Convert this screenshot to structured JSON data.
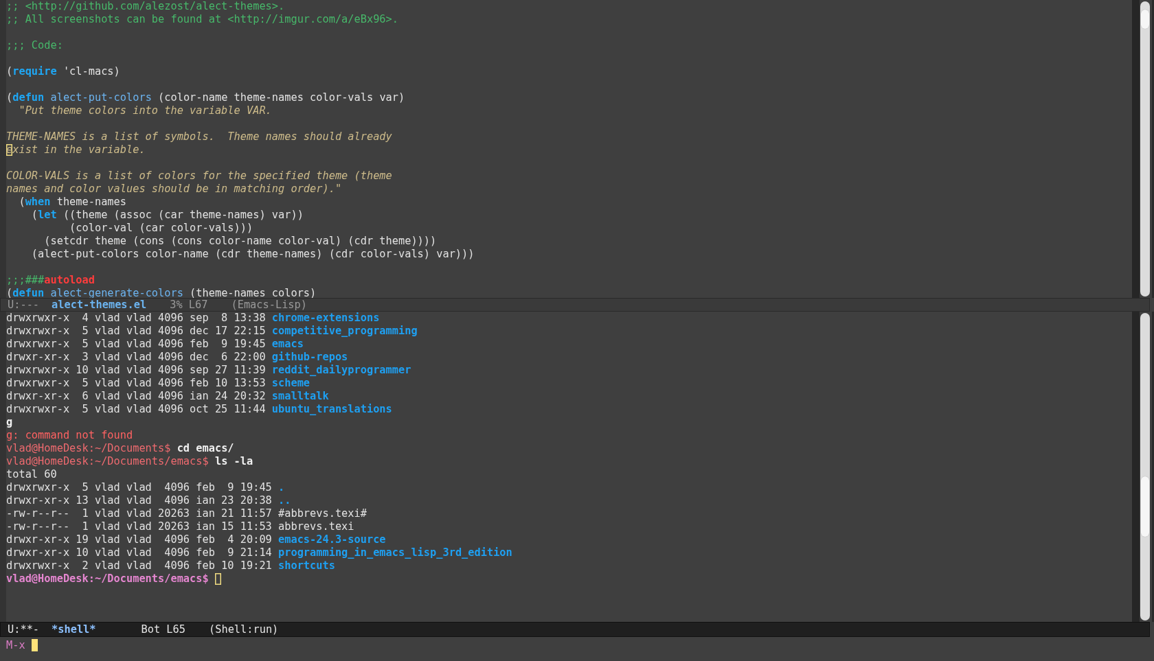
{
  "editor": {
    "lines": [
      {
        "kind": "code",
        "segments": [
          {
            "kind": "comment",
            "text": ";; <http://github.com/alezost/alect-themes>."
          }
        ]
      },
      {
        "kind": "code",
        "segments": [
          {
            "kind": "comment",
            "text": ";; All screenshots can be found at <http://imgur.com/a/eBx96>."
          }
        ]
      },
      {
        "kind": "blank"
      },
      {
        "kind": "code",
        "segments": [
          {
            "kind": "comment",
            "text": ";;; Code:"
          }
        ]
      },
      {
        "kind": "blank"
      },
      {
        "kind": "code",
        "segments": [
          {
            "kind": "plain",
            "text": "("
          },
          {
            "kind": "keyword",
            "text": "require"
          },
          {
            "kind": "plain",
            "text": " 'cl-macs)"
          }
        ]
      },
      {
        "kind": "blank"
      },
      {
        "kind": "code",
        "segments": [
          {
            "kind": "plain",
            "text": "("
          },
          {
            "kind": "keyword",
            "text": "defun"
          },
          {
            "kind": "function",
            "text": "alect-put-colors",
            "gap": true
          },
          {
            "kind": "plain",
            "text": " (color-name theme-names color-vals var)"
          }
        ]
      },
      {
        "kind": "code",
        "segments": [
          {
            "kind": "doc",
            "text": "  \"Put theme colors into the variable VAR."
          }
        ]
      },
      {
        "kind": "blank"
      },
      {
        "kind": "code",
        "segments": [
          {
            "kind": "doc",
            "text": "THEME-NAMES is a list of symbols.  Theme names should already"
          }
        ]
      },
      {
        "kind": "code",
        "segments": [
          {
            "kind": "cursor",
            "text": "e"
          },
          {
            "kind": "doc",
            "text": "xist in the variable."
          }
        ]
      },
      {
        "kind": "blank"
      },
      {
        "kind": "code",
        "segments": [
          {
            "kind": "doc",
            "text": "COLOR-VALS is a list of colors for the specified theme (theme"
          }
        ]
      },
      {
        "kind": "code",
        "segments": [
          {
            "kind": "doc",
            "text": "names and color values should be in matching order).\""
          }
        ]
      },
      {
        "kind": "code",
        "segments": [
          {
            "kind": "plain",
            "text": "  ("
          },
          {
            "kind": "keyword",
            "text": "when"
          },
          {
            "kind": "plain",
            "text": " theme-names"
          }
        ]
      },
      {
        "kind": "code",
        "segments": [
          {
            "kind": "plain",
            "text": "    ("
          },
          {
            "kind": "keyword",
            "text": "let"
          },
          {
            "kind": "plain",
            "text": " ((theme (assoc (car theme-names) var))"
          }
        ]
      },
      {
        "kind": "code",
        "segments": [
          {
            "kind": "plain",
            "text": "          (color-val (car color-vals)))"
          }
        ]
      },
      {
        "kind": "code",
        "segments": [
          {
            "kind": "plain",
            "text": "      (setcdr theme (cons (cons color-name color-val) (cdr theme))))"
          }
        ]
      },
      {
        "kind": "code",
        "segments": [
          {
            "kind": "plain",
            "text": "    (alect-put-colors color-name (cdr theme-names) (cdr color-vals) var)))"
          }
        ]
      },
      {
        "kind": "blank"
      },
      {
        "kind": "code",
        "segments": [
          {
            "kind": "comment",
            "text": ";;;###"
          },
          {
            "kind": "warning",
            "text": "autoload"
          }
        ]
      },
      {
        "kind": "code",
        "segments": [
          {
            "kind": "plain",
            "text": "("
          },
          {
            "kind": "keyword",
            "text": "defun"
          },
          {
            "kind": "function",
            "text": "alect-generate-colors",
            "gap": true
          },
          {
            "kind": "plain",
            "text": " (theme-names colors)"
          }
        ]
      }
    ],
    "mode_line": {
      "active": false,
      "status": "U:---",
      "buffer": "alect-themes.el",
      "position": "3% L67",
      "mode": "(Emacs-Lisp)"
    }
  },
  "shell": {
    "lines": [
      {
        "kind": "code",
        "segments": [
          {
            "kind": "plain",
            "text": "drwxrwxr-x  4 vlad vlad 4096 sep  8 13:38 "
          },
          {
            "kind": "dir",
            "text": "chrome-extensions"
          }
        ]
      },
      {
        "kind": "code",
        "segments": [
          {
            "kind": "plain",
            "text": "drwxrwxr-x  5 vlad vlad 4096 dec 17 22:15 "
          },
          {
            "kind": "dir",
            "text": "competitive_programming"
          }
        ]
      },
      {
        "kind": "code",
        "segments": [
          {
            "kind": "plain",
            "text": "drwxrwxr-x  5 vlad vlad 4096 feb  9 19:45 "
          },
          {
            "kind": "dir",
            "text": "emacs"
          }
        ]
      },
      {
        "kind": "code",
        "segments": [
          {
            "kind": "plain",
            "text": "drwxr-xr-x  3 vlad vlad 4096 dec  6 22:00 "
          },
          {
            "kind": "dir",
            "text": "github-repos"
          }
        ]
      },
      {
        "kind": "code",
        "segments": [
          {
            "kind": "plain",
            "text": "drwxrwxr-x 10 vlad vlad 4096 sep 27 11:39 "
          },
          {
            "kind": "dir",
            "text": "reddit_dailyprogrammer"
          }
        ]
      },
      {
        "kind": "code",
        "segments": [
          {
            "kind": "plain",
            "text": "drwxrwxr-x  5 vlad vlad 4096 feb 10 13:53 "
          },
          {
            "kind": "dir",
            "text": "scheme"
          }
        ]
      },
      {
        "kind": "code",
        "segments": [
          {
            "kind": "plain",
            "text": "drwxr-xr-x  6 vlad vlad 4096 ian 24 20:32 "
          },
          {
            "kind": "dir",
            "text": "smalltalk"
          }
        ]
      },
      {
        "kind": "code",
        "segments": [
          {
            "kind": "plain",
            "text": "drwxrwxr-x  5 vlad vlad 4096 oct 25 11:44 "
          },
          {
            "kind": "dir",
            "text": "ubuntu_translations"
          }
        ]
      },
      {
        "kind": "code",
        "segments": [
          {
            "kind": "command",
            "text": "g"
          }
        ]
      },
      {
        "kind": "code",
        "segments": [
          {
            "kind": "error",
            "text": "g: command not found"
          }
        ]
      },
      {
        "kind": "code",
        "segments": [
          {
            "kind": "prompt",
            "text": "vlad@HomeDesk:~/Documents$"
          },
          {
            "kind": "command",
            "text": " cd emacs/"
          }
        ]
      },
      {
        "kind": "code",
        "segments": [
          {
            "kind": "prompt",
            "text": "vlad@HomeDesk:~/Documents/emacs$"
          },
          {
            "kind": "command",
            "text": " ls -la"
          }
        ]
      },
      {
        "kind": "code",
        "segments": [
          {
            "kind": "plain",
            "text": "total 60"
          }
        ]
      },
      {
        "kind": "code",
        "segments": [
          {
            "kind": "plain",
            "text": "drwxrwxr-x  5 vlad vlad  4096 feb  9 19:45 "
          },
          {
            "kind": "dir",
            "text": "."
          }
        ]
      },
      {
        "kind": "code",
        "segments": [
          {
            "kind": "plain",
            "text": "drwxr-xr-x 13 vlad vlad  4096 ian 23 20:38 "
          },
          {
            "kind": "dir",
            "text": ".."
          }
        ]
      },
      {
        "kind": "code",
        "segments": [
          {
            "kind": "plain",
            "text": "-rw-r--r--  1 vlad vlad 20263 ian 21 11:57 #abbrevs.texi#"
          }
        ]
      },
      {
        "kind": "code",
        "segments": [
          {
            "kind": "plain",
            "text": "-rw-r--r--  1 vlad vlad 20263 ian 15 11:53 abbrevs.texi"
          }
        ]
      },
      {
        "kind": "code",
        "segments": [
          {
            "kind": "plain",
            "text": "drwxr-xr-x 19 vlad vlad  4096 feb  4 20:09 "
          },
          {
            "kind": "dir",
            "text": "emacs-24.3-source"
          }
        ]
      },
      {
        "kind": "code",
        "segments": [
          {
            "kind": "plain",
            "text": "drwxr-xr-x 10 vlad vlad  4096 feb  9 21:14 "
          },
          {
            "kind": "dir",
            "text": "programming_in_emacs_lisp_3rd_edition"
          }
        ]
      },
      {
        "kind": "code",
        "segments": [
          {
            "kind": "plain",
            "text": "drwxrwxr-x  2 vlad vlad  4096 feb 10 19:21 "
          },
          {
            "kind": "dir",
            "text": "shortcuts"
          }
        ]
      },
      {
        "kind": "code",
        "segments": [
          {
            "kind": "active-prompt",
            "text": "vlad@HomeDesk:~/Documents/emacs$ "
          },
          {
            "kind": "cursor"
          }
        ]
      }
    ],
    "mode_line": {
      "active": true,
      "status": "U:**-",
      "buffer": "*shell*",
      "position": "Bot L65",
      "mode": "(Shell:run)"
    }
  },
  "minibuffer": {
    "prompt": "M-x"
  }
}
